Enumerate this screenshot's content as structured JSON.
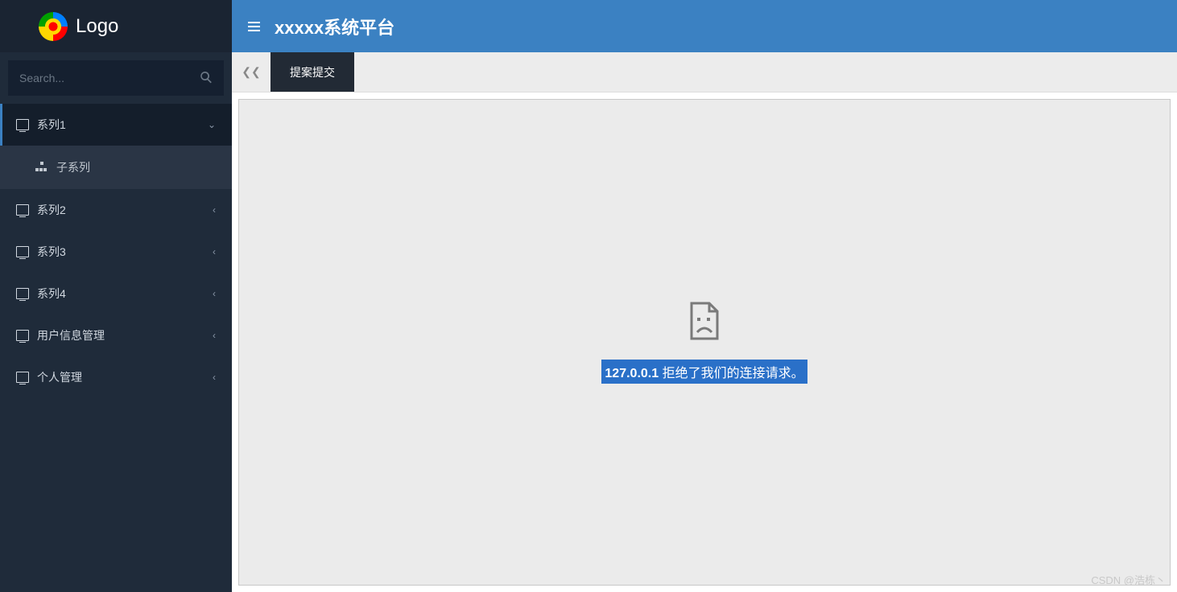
{
  "brand": {
    "text": "Logo"
  },
  "header": {
    "title": "xxxxx系统平台"
  },
  "search": {
    "placeholder": "Search..."
  },
  "sidebar": {
    "items": [
      {
        "label": "系列1",
        "expanded": true,
        "children": [
          {
            "label": "子系列"
          }
        ]
      },
      {
        "label": "系列2"
      },
      {
        "label": "系列3"
      },
      {
        "label": "系列4"
      },
      {
        "label": "用户信息管理"
      },
      {
        "label": "个人管理"
      }
    ]
  },
  "tabs": {
    "active": {
      "label": "提案提交"
    }
  },
  "error": {
    "ip": "127.0.0.1",
    "message": " 拒绝了我们的连接请求。"
  },
  "watermark": "CSDN @浩栋丶"
}
